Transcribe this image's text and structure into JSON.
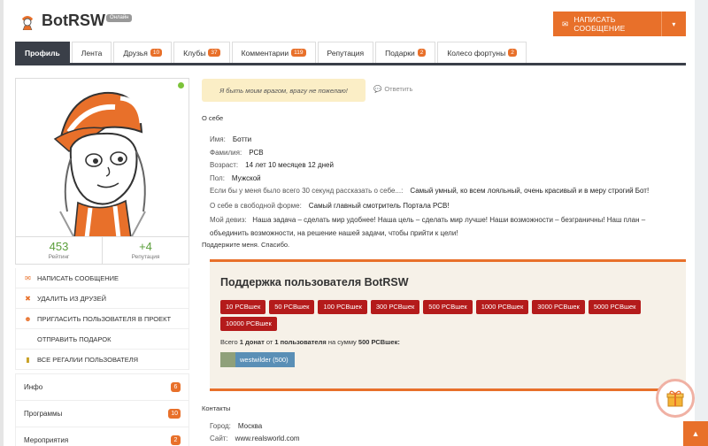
{
  "profile": {
    "name": "BotRSW",
    "status_badge": "Онлайн",
    "message_button": "НАПИСАТЬ СООБЩЕНИЕ"
  },
  "tabs": [
    {
      "label": "Профиль",
      "count": ""
    },
    {
      "label": "Лента",
      "count": ""
    },
    {
      "label": "Друзья",
      "count": "10"
    },
    {
      "label": "Клубы",
      "count": "37"
    },
    {
      "label": "Комментарии",
      "count": "119"
    },
    {
      "label": "Репутация",
      "count": ""
    },
    {
      "label": "Подарки",
      "count": "2"
    },
    {
      "label": "Колесо фортуны",
      "count": "2"
    }
  ],
  "stats": {
    "rating_value": "453",
    "rating_label": "Рейтинг",
    "reputation_value": "+4",
    "reputation_label": "Репутация"
  },
  "actions": [
    {
      "label": "НАПИСАТЬ СООБЩЕНИЕ",
      "icon": "envelope-icon"
    },
    {
      "label": "УДАЛИТЬ ИЗ ДРУЗЕЙ",
      "icon": "close-icon"
    },
    {
      "label": "ПРИГЛАСИТЬ ПОЛЬЗОВАТЕЛЯ В ПРОЕКТ",
      "icon": "users-icon"
    },
    {
      "label": "ОТПРАВИТЬ ПОДАРОК",
      "icon": ""
    },
    {
      "label": "ВСЕ РЕГАЛИИ ПОЛЬЗОВАТЕЛЯ",
      "icon": "medal-icon"
    }
  ],
  "side_list": [
    {
      "label": "Инфо",
      "count": "6"
    },
    {
      "label": "Программы",
      "count": "10"
    },
    {
      "label": "Мероприятия",
      "count": "2"
    }
  ],
  "status_text": "Я быть моим врагом, врагу не пожелаю!",
  "reply_label": "Ответить",
  "about": {
    "title": "О себе",
    "rows": [
      {
        "k": "Имя:",
        "v": "Ботти"
      },
      {
        "k": "Фамилия:",
        "v": "РСВ"
      },
      {
        "k": "Возраст:",
        "v": "14 лет 10 месяцев 12 дней"
      },
      {
        "k": "Пол:",
        "v": "Мужской"
      },
      {
        "k": "Если бы у меня было всего 30 секунд рассказать о себе...:",
        "v": "Самый умный, ко всем лояльный, очень красивый и в меру строгий Бот!"
      },
      {
        "k": "О себе в свободной форме:",
        "v": "Самый главный смотритель Портала РСВ!"
      }
    ],
    "motto_key": "Мой девиз:",
    "motto_value": "Наша задача – сделать мир удобнее! Наша цель – сделать мир лучше! Наши возможности – безграничны! Наш план – объединить возможности, на решение нашей задачи, чтобы прийти к цели!"
  },
  "support": {
    "note": "Поддержите меня. Спасибо.",
    "title": "Поддержка пользователя BotRSW",
    "donate_buttons": [
      "10 РСВшек",
      "50 РСВшек",
      "100 РСВшек",
      "300 РСВшек",
      "500 РСВшек",
      "1000 РСВшек",
      "3000 РСВшек",
      "5000 РСВшек",
      "10000 РСВшек"
    ],
    "total_prefix": "Всего",
    "total_donations": "1 донат",
    "total_from": "от",
    "total_users": "1 пользователя",
    "total_sum_label": "на сумму",
    "total_sum": "500 РСВшек:",
    "donor": "westwilder (500)"
  },
  "contacts": {
    "title": "Контакты",
    "city_label": "Город:",
    "city": "Москва",
    "site_label": "Сайт:",
    "site": "www.realsworld.com"
  },
  "colors": {
    "accent": "#e8702a",
    "dark_tab": "#3a3f48",
    "donate": "#b41b1b"
  }
}
